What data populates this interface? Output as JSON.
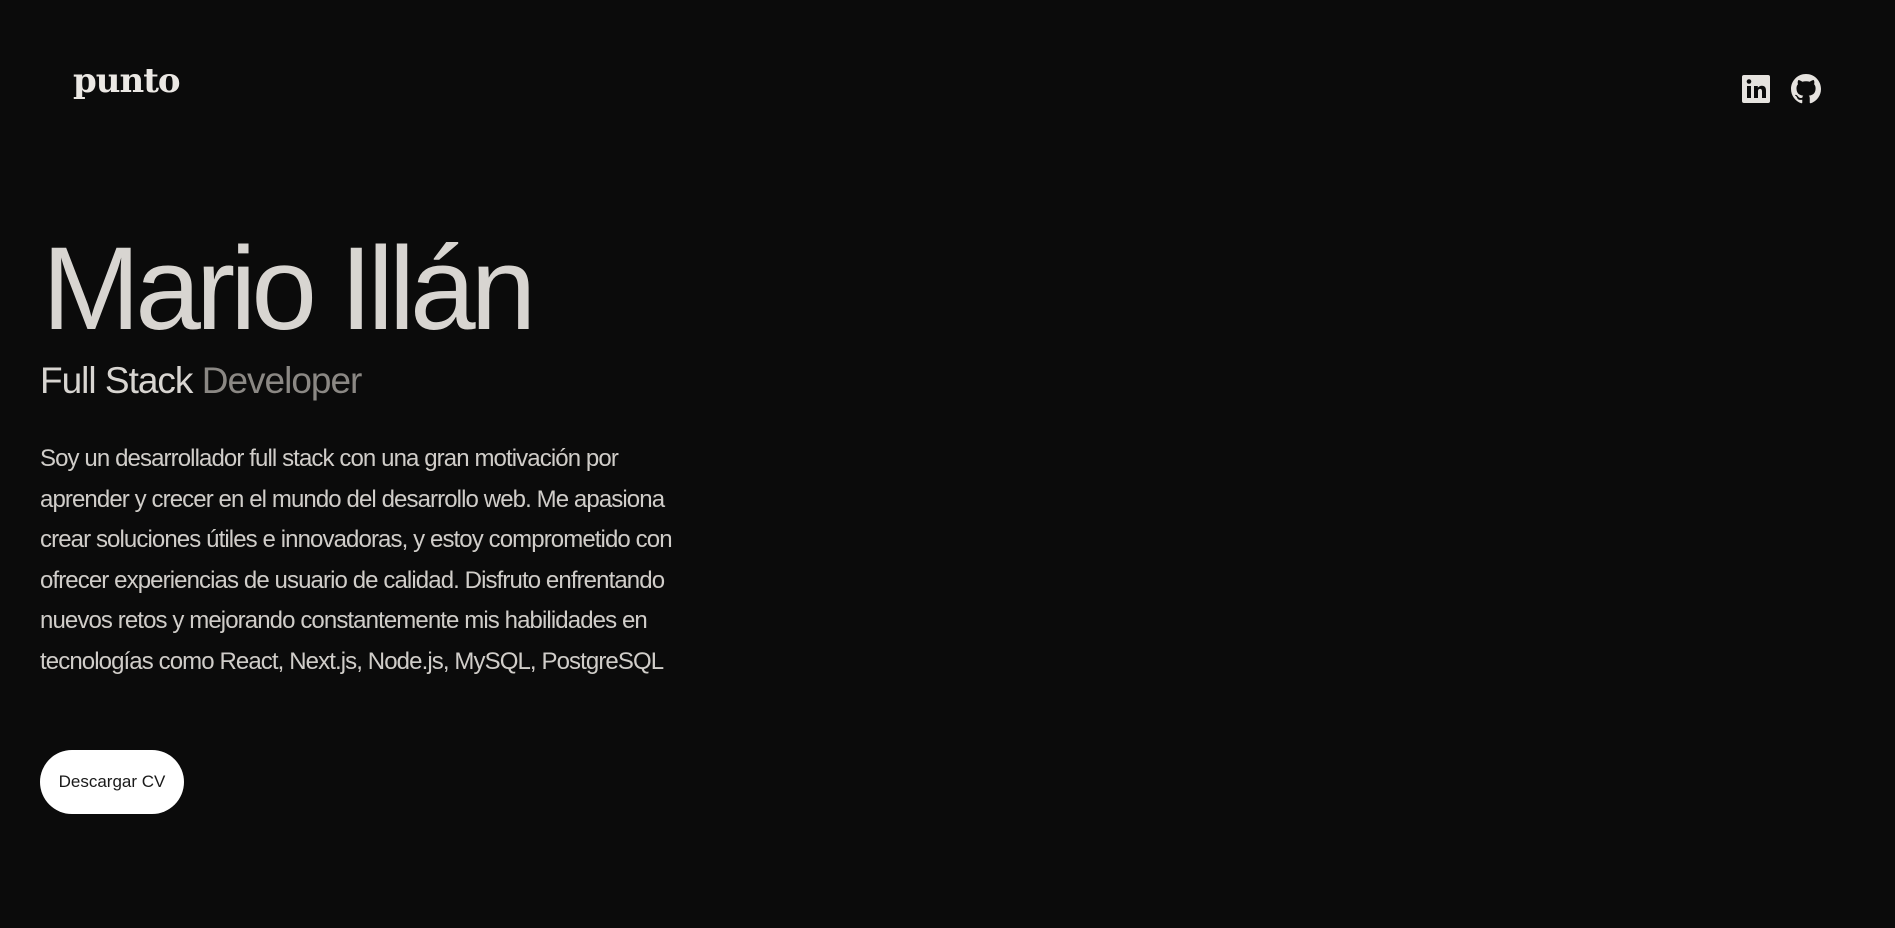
{
  "header": {
    "logo_text": "punto",
    "socials": [
      {
        "icon": "linkedin-icon",
        "label": "LinkedIn"
      },
      {
        "icon": "github-icon",
        "label": "GitHub"
      }
    ]
  },
  "hero": {
    "name": "Mario Illán",
    "role_primary": "Full Stack",
    "role_secondary": "Developer",
    "bio": "Soy un desarrollador full stack con una gran motivación por aprender y crecer en el mundo del desarrollo web. Me apasiona crear soluciones útiles e innovadoras, y estoy comprometido con ofrecer experiencias de usuario de calidad. Disfruto enfrentando nuevos retos y mejorando constantemente mis habilidades en tecnologías como React, Next.js, Node.js, MySQL, PostgreSQL",
    "cv_button_label": "Descargar CV"
  },
  "colors": {
    "background": "#0b0b0b",
    "text_primary": "#d8d5d1",
    "text_muted": "#8b8884",
    "button_bg": "#ffffff",
    "button_text": "#1a1a1a"
  }
}
